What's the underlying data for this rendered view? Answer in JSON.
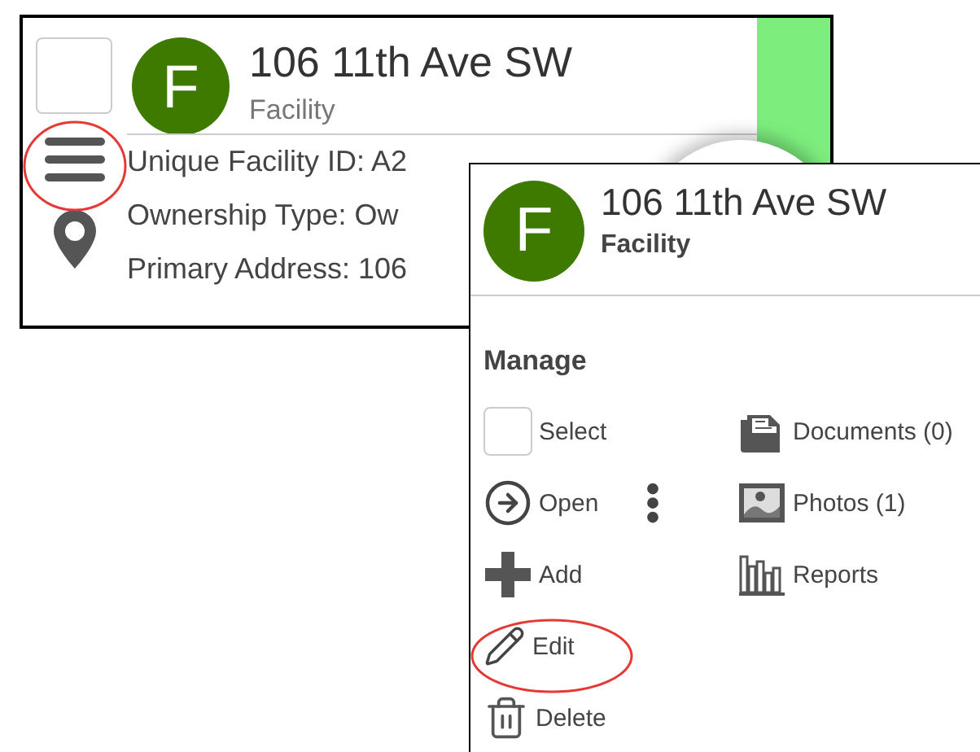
{
  "card": {
    "checked": false,
    "avatar_letter": "F",
    "title": "106 11th Ave SW",
    "subtitle": "Facility",
    "fields": [
      "Unique Facility ID: A2",
      "Ownership Type: Ow",
      "Primary Address: 106"
    ]
  },
  "popup": {
    "avatar_letter": "F",
    "title": "106 11th Ave SW",
    "subtitle": "Facility",
    "section_title": "Manage",
    "actions": [
      {
        "kind": "select",
        "label": "Select",
        "checked": false
      },
      {
        "kind": "open",
        "label": "Open"
      },
      {
        "kind": "add",
        "label": "Add"
      },
      {
        "kind": "edit",
        "label": "Edit"
      },
      {
        "kind": "delete",
        "label": "Delete"
      }
    ],
    "links": [
      {
        "kind": "documents",
        "label": "Documents (0)"
      },
      {
        "kind": "photos",
        "label": "Photos (1)"
      },
      {
        "kind": "reports",
        "label": "Reports"
      }
    ]
  }
}
